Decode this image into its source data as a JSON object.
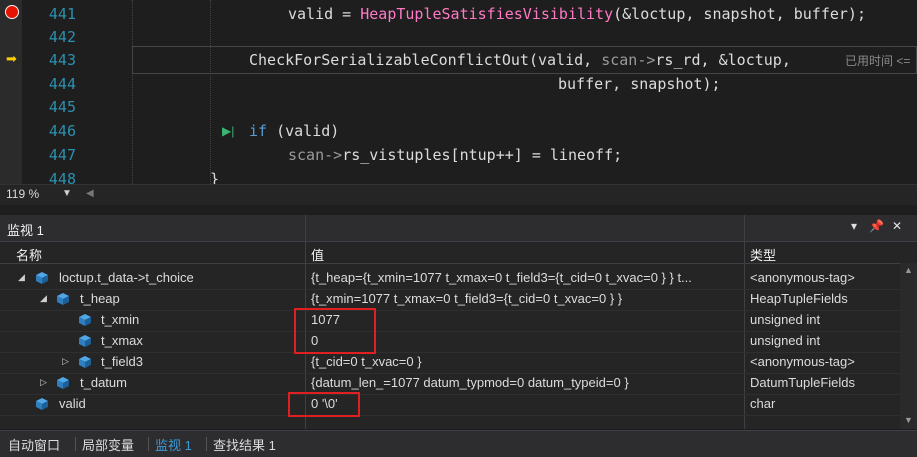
{
  "editor": {
    "lines": [
      {
        "num": "441",
        "marker": "breakpoint"
      },
      {
        "num": "442"
      },
      {
        "num": "443",
        "marker": "current"
      },
      {
        "num": "444"
      },
      {
        "num": "445"
      },
      {
        "num": "446"
      },
      {
        "num": "447"
      },
      {
        "num": "448"
      }
    ],
    "code441a": "valid = ",
    "code441b": "HeapTupleSatisfiesVisibility",
    "code441c": "(&loctup, snapshot, buffer);",
    "code443a": "CheckForSerializableConflictOut(valid, ",
    "code443b": "scan->",
    "code443c": "rs_rd, &loctup, ",
    "perf_tip": "已用时间 <=",
    "code444": "buffer, snapshot);",
    "code446a": "if",
    "code446b": " (valid)",
    "code447a": "scan->",
    "code447b": "rs_vistuples[ntup++] = lineoff;",
    "code448": "}"
  },
  "zoom": {
    "level": "119 %"
  },
  "watch": {
    "title": "监视 1",
    "columns": {
      "name": "名称",
      "value": "值",
      "type": "类型"
    },
    "rows": [
      {
        "name": "loctup.t_data->t_choice",
        "value": "{t_heap={t_xmin=1077 t_xmax=0 t_field3={t_cid=0 t_xvac=0 } } t...",
        "type": "<anonymous-tag>",
        "expanded": true
      },
      {
        "name": "t_heap",
        "value": "{t_xmin=1077 t_xmax=0 t_field3={t_cid=0 t_xvac=0 } }",
        "type": "HeapTupleFields",
        "expanded": true
      },
      {
        "name": "t_xmin",
        "value": "1077",
        "type": "unsigned int"
      },
      {
        "name": "t_xmax",
        "value": "0",
        "type": "unsigned int"
      },
      {
        "name": "t_field3",
        "value": "{t_cid=0 t_xvac=0 }",
        "type": "<anonymous-tag>",
        "expanded": false
      },
      {
        "name": "t_datum",
        "value": "{datum_len_=1077 datum_typmod=0 datum_typeid=0 }",
        "type": "DatumTupleFields",
        "expanded": false
      },
      {
        "name": "valid",
        "value": "0 '\\0'",
        "type": "char"
      }
    ]
  },
  "tabs": [
    {
      "label": "自动窗口"
    },
    {
      "label": "局部变量"
    },
    {
      "label": "监视 1",
      "active": true
    },
    {
      "label": "查找结果 1"
    }
  ],
  "colors": {
    "accent": "#3c9bd9",
    "function": "#ff79c6",
    "keyword": "#569cd6",
    "highlight": "#e02020"
  }
}
